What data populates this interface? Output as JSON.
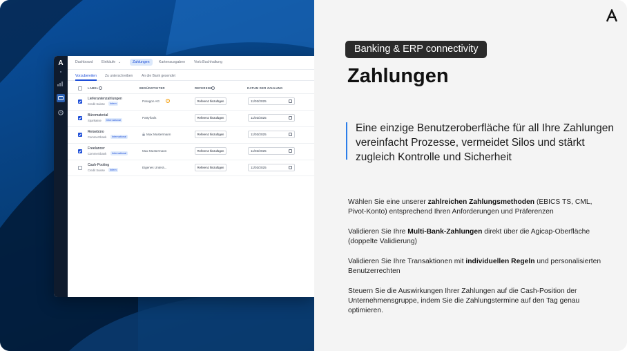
{
  "left": {
    "app": {
      "logo": "A",
      "nav": [
        "Dashboard",
        "Einkäufe",
        "Zahlungen",
        "Kartenausgaben",
        "Vorb.Buchhaltung"
      ],
      "nav_active": "Zahlungen",
      "subtabs": [
        "Vorzubereiten",
        "Zu unterschreiben",
        "An die Bank gesendet"
      ],
      "subtab_active": "Vorzubereiten",
      "columns": [
        "LABEL",
        "BEGÜNSTIGTER",
        "REFERENZ",
        "DATUM DER ZAHLUNG"
      ],
      "rows": [
        {
          "label": "Lieferantenzahlungen",
          "bank": "Credit Suisse",
          "badge": "Intern",
          "beneficiary": "Paragon AG",
          "ref_button": "Referenz hinzufügen",
          "date": "11/03/2025",
          "checked": true
        },
        {
          "label": "Büromaterial",
          "bank": "Sparkasse",
          "badge": "International",
          "beneficiary": "Partyfools",
          "ref_button": "Referenz hinzufügen",
          "date": "11/03/2025",
          "checked": true
        },
        {
          "label": "Reisebüro",
          "bank": "Commerzbank",
          "badge": "International",
          "beneficiary": "Max Mustermann",
          "ref_button": "Referenz hinzufügen",
          "date": "11/03/2025",
          "checked": true
        },
        {
          "label": "Freelancer",
          "bank": "Commerzbank",
          "badge": "International",
          "beneficiary": "Max Mustermann",
          "ref_button": "Referenz hinzufügen",
          "date": "11/03/2025",
          "checked": true
        },
        {
          "label": "Cash-Pooling",
          "bank": "Credit Suisse",
          "badge": "Intern",
          "beneficiary": "Eigenes Unterä...",
          "ref_button": "Referenz hinzufügen",
          "date": "11/03/2025",
          "checked": false
        }
      ]
    }
  },
  "right": {
    "brand_logo": "A",
    "tag": "Banking & ERP connectivity",
    "title": "Zahlungen",
    "quote": "Eine einzige Benutzeroberfläche für all Ihre Zahlungen vereinfacht Prozesse, vermeidet Silos und stärkt zugleich Kontrolle und Sicherheit",
    "paragraphs": [
      {
        "pre": "Wählen Sie eine unserer ",
        "bold": "zahlreichen Zahlungsmethoden",
        "post": " (EBICS TS, CML, Pivot-Konto) entsprechend Ihren Anforderungen und Präferenzen"
      },
      {
        "pre": "Validieren Sie Ihre ",
        "bold": "Multi-Bank-Zahlungen",
        "post": " direkt über die Agicap-Oberfläche (doppelte Validierung)"
      },
      {
        "pre": "Validieren Sie Ihre Transaktionen mit ",
        "bold": "individuellen Regeln",
        "post": " und personalisierten Benutzerrechten"
      },
      {
        "pre": "Steuern Sie die Auswirkungen Ihrer Zahlungen auf die Cash-Position der Unternehmensgruppe, indem Sie die Zahlungstermine auf den Tag genau optimieren.",
        "bold": "",
        "post": ""
      }
    ]
  },
  "colors": {
    "accent_blue": "#1d4ed8",
    "quote_bar": "#2b7de9",
    "panel_blue": "#07417f",
    "pill_bg": "#2b2b2b"
  }
}
